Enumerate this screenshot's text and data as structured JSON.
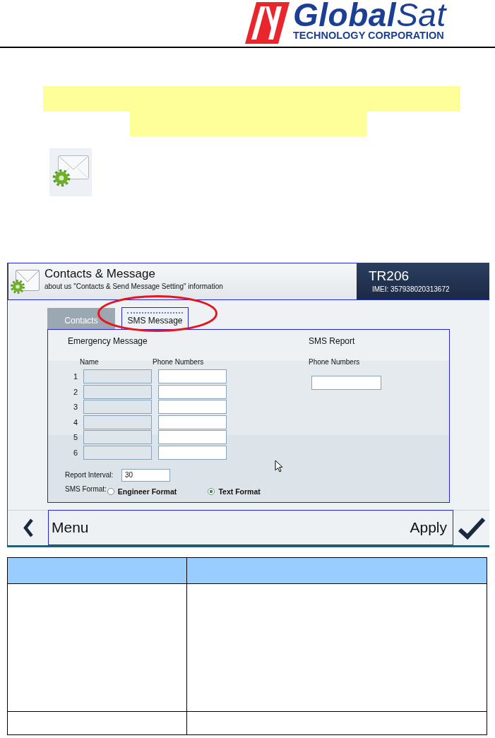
{
  "header": {
    "brand": "**Global**Sat",
    "tagline": "TECHNOLOGY CORPORATION"
  },
  "screen": {
    "title": "Contacts & Message",
    "subtitle": "about us \"Contacts & Send Message Setting\" information",
    "device": {
      "model": "TR206",
      "imei": "IMEI: 357938020313672"
    },
    "tabs": [
      {
        "label": "Contacts",
        "selected": false
      },
      {
        "label": "SMS Message",
        "selected": true
      }
    ],
    "emergency": {
      "heading": "Emergency Message",
      "columns": [
        "Name",
        "Phone Numbers"
      ],
      "rows": [
        {
          "number": "1",
          "name_disabled": true
        },
        {
          "number": "2",
          "name_disabled": true
        },
        {
          "number": "3",
          "name_disabled": true
        },
        {
          "number": "4",
          "name_disabled": true
        },
        {
          "number": "5",
          "name_disabled": true
        },
        {
          "number": "6",
          "name_disabled": true
        }
      ]
    },
    "sms_report": {
      "heading": "SMS Report",
      "column": "Phone Numbers"
    },
    "report_interval": {
      "label": "Report Interval:",
      "value": "30"
    },
    "sms_format": {
      "label": "SMS Format:",
      "options": [
        {
          "label": "Engineer Format",
          "selected": false
        },
        {
          "label": "Text Format",
          "selected": true
        }
      ]
    },
    "bottom_bar": {
      "menu": "Menu",
      "apply": "Apply"
    }
  }
}
